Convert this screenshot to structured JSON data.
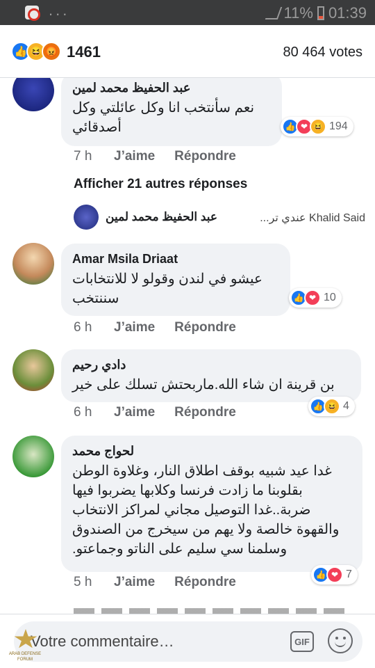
{
  "status_bar": {
    "battery_text": "11%",
    "time": "01:39"
  },
  "header": {
    "reaction_count": "1461",
    "votes": "80 464 votes"
  },
  "actions": {
    "like": "J’aime",
    "reply": "Répondre"
  },
  "comments": [
    {
      "author": "عبد الحفيظ محمد لمين",
      "text": "نعم سأنتخب انا وكل عائلتي وكل أصدقائي",
      "time": "7 h",
      "reactions": "194"
    },
    {
      "author": "Amar Msila Driaat",
      "text": "عيشو في لندن وقولو لا للانتخابات سننتخب",
      "time": "6 h",
      "reactions": "10"
    },
    {
      "author": "دادي رحيم",
      "text": "بن قرينة ان شاء الله.ماربحتش تسلك على خير",
      "time": "6 h",
      "reactions": "4"
    },
    {
      "author": "لحواج محمد",
      "text": "غدا عيد شبيه بوقف اطلاق النار، وغلاوة الوطن بقلوبنا ما زادت فرنسا وكلابها يضربوا فيها ضربة..غدا التوصيل مجاني لمراكز الانتخاب والقهوة خالصة ولا يهم من سيخرج من الصندوق وسلمنا سي سليم على الناتو وجماعتو.",
      "time": "5 h",
      "reactions": "7"
    }
  ],
  "more_replies": "Afficher 21 autres réponses",
  "reply_preview": {
    "author": "عبد الحفيظ محمد لمين",
    "text": "Khalid Said عندي تر..."
  },
  "composer": {
    "placeholder": "Votre commentaire…",
    "gif_label": "GIF"
  },
  "colors": {
    "like": "#1877f2",
    "love": "#f33e58",
    "haha": "#f7b125",
    "angry": "#e9710f",
    "bubble": "#f0f2f5"
  }
}
